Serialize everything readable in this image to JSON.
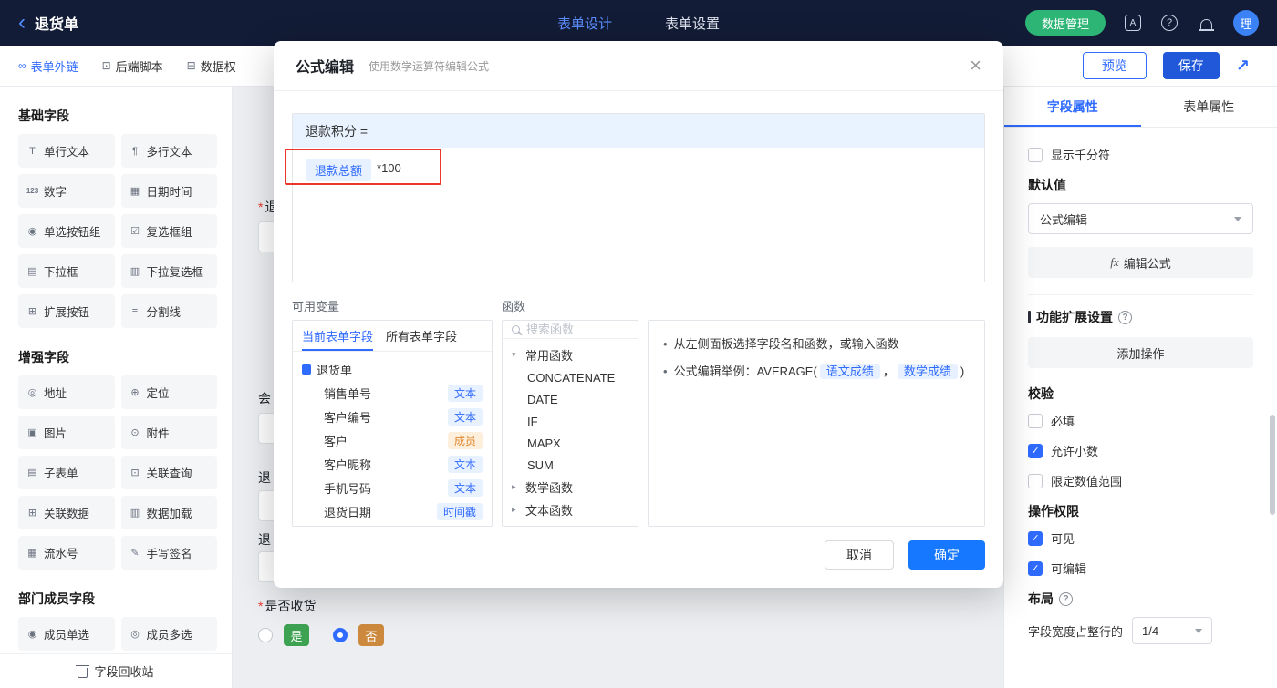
{
  "colors": {
    "accent_blue": "#2f6bff",
    "topbar_bg": "#131c36",
    "green_button": "#2cb574",
    "save_blue": "#2158d9",
    "confirm_blue": "#1677ff",
    "annotation_red": "#e8382d",
    "badge_orange": "#e0882e",
    "yes_badge_green": "#3ea253",
    "no_badge_orange": "#cd8a3e"
  },
  "topbar": {
    "back": "退货单",
    "design_tab": "表单设计",
    "settings_tab": "表单设置",
    "data_manage": "数据管理",
    "avatar": "理"
  },
  "toolbar": {
    "item1": {
      "icon": "∞",
      "label": "表单外链"
    },
    "item2": {
      "icon": "⊡",
      "label": "后端脚本"
    },
    "item3": {
      "icon": "⊟",
      "label": "数据权"
    },
    "preview": "预览",
    "save": "保存"
  },
  "palette": {
    "sections": [
      {
        "title": "基础字段",
        "items": [
          {
            "icon": "T",
            "label": "单行文本"
          },
          {
            "icon": "¶",
            "label": "多行文本"
          },
          {
            "icon": "123",
            "label": "数字"
          },
          {
            "icon": "▦",
            "label": "日期时间"
          },
          {
            "icon": "◉",
            "label": "单选按钮组"
          },
          {
            "icon": "☑",
            "label": "复选框组"
          },
          {
            "icon": "▤",
            "label": "下拉框"
          },
          {
            "icon": "▥",
            "label": "下拉复选框"
          },
          {
            "icon": "⊞",
            "label": "扩展按钮"
          },
          {
            "icon": "≡",
            "label": "分割线"
          }
        ]
      },
      {
        "title": "增强字段",
        "items": [
          {
            "icon": "◎",
            "label": "地址"
          },
          {
            "icon": "⊕",
            "label": "定位"
          },
          {
            "icon": "▣",
            "label": "图片"
          },
          {
            "icon": "⊙",
            "label": "附件"
          },
          {
            "icon": "▤",
            "label": "子表单"
          },
          {
            "icon": "⊡",
            "label": "关联查询"
          },
          {
            "icon": "⊞",
            "label": "关联数据"
          },
          {
            "icon": "▥",
            "label": "数据加载"
          },
          {
            "icon": "▦",
            "label": "流水号"
          },
          {
            "icon": "✎",
            "label": "手写签名"
          }
        ]
      },
      {
        "title": "部门成员字段",
        "items": [
          {
            "icon": "◉",
            "label": "成员单选"
          },
          {
            "icon": "◎",
            "label": "成员多选"
          }
        ]
      }
    ],
    "recycle": "字段回收站"
  },
  "canvas": {
    "frag1_mark": "*",
    "frag1": "退",
    "frag2": "会",
    "frag3": "退",
    "frag4": "退",
    "receive_mark": "*",
    "receive_label": "是否收货",
    "options": [
      {
        "label": "是",
        "selected": false
      },
      {
        "label": "否",
        "selected": true
      }
    ]
  },
  "modal": {
    "title": "公式编辑",
    "subtitle": "使用数学运算符编辑公式",
    "formula_target": "退款积分 =",
    "formula_chip": "退款总额",
    "formula_expr": "*100",
    "vars_label": "可用变量",
    "vars_tab_current": "当前表单字段",
    "vars_tab_all": "所有表单字段",
    "vars_root": "退货单",
    "fields": [
      {
        "name": "销售单号",
        "type": "文本"
      },
      {
        "name": "客户编号",
        "type": "文本"
      },
      {
        "name": "客户",
        "type": "成员"
      },
      {
        "name": "客户昵称",
        "type": "文本"
      },
      {
        "name": "手机号码",
        "type": "文本"
      },
      {
        "name": "退货日期",
        "type": "时间戳"
      }
    ],
    "fn_label": "函数",
    "fn_search": "搜索函数",
    "fn_group1": "常用函数",
    "fn_items": [
      "CONCATENATE",
      "DATE",
      "IF",
      "MAPX",
      "SUM"
    ],
    "fn_group2": "数学函数",
    "fn_group3": "文本函数",
    "help1": "从左侧面板选择字段名和函数，或输入函数",
    "help2_prefix": "公式编辑举例：AVERAGE(",
    "help_chip1": "语文成绩",
    "help_comma": "，",
    "help_chip2": "数学成绩",
    "help2_suffix": ")",
    "cancel": "取消",
    "confirm": "确定"
  },
  "panel": {
    "tab_field": "字段属性",
    "tab_form": "表单属性",
    "thousand": {
      "label": "显示千分符",
      "checked": false
    },
    "default_title": "默认值",
    "default_value": "公式编辑",
    "fx_icon": "fx",
    "fx_label": "编辑公式",
    "ext_title": "功能扩展设置",
    "add_action": "添加操作",
    "check_title": "校验",
    "checks": [
      {
        "label": "必填",
        "checked": false
      },
      {
        "label": "允许小数",
        "checked": true
      },
      {
        "label": "限定数值范围",
        "checked": false
      }
    ],
    "perm_title": "操作权限",
    "perms": [
      {
        "label": "可见",
        "checked": true
      },
      {
        "label": "可编辑",
        "checked": true
      }
    ],
    "layout_title": "布局",
    "width_label": "字段宽度占整行的",
    "width_value": "1/4"
  }
}
